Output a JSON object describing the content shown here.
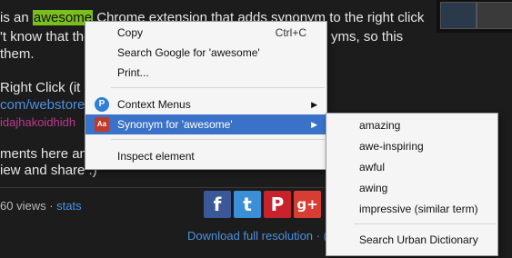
{
  "post": {
    "line1_before": " is an ",
    "highlighted_word": "awesome",
    "line1_after": " Chrome extension that adds synonym to the right click",
    "line2": "'t know that the",
    "line2_right": "yms, so this",
    "line3": " them.",
    "line4": "Right Click (it is",
    "line5_link": "com/webstore/",
    "line6_link": "idajhakoidhidh",
    "line7": "ments here an",
    "line8": "iew and share :)"
  },
  "footer": {
    "views_text": "60 views · ",
    "stats_link": "stats",
    "download_link": "Download full resolution",
    "download_suffix": " · ("
  },
  "social": {
    "facebook": "f",
    "twitter": "t",
    "pinterest": "P",
    "googleplus": "g+"
  },
  "context_menu": {
    "copy": "Copy",
    "copy_shortcut": "Ctrl+C",
    "search_google": "Search Google for 'awesome'",
    "print": "Print...",
    "context_menus": "Context Menus",
    "context_menus_icon": "P",
    "synonym": "Synonym for 'awesome'",
    "synonym_icon": "Aa",
    "inspect": "Inspect element"
  },
  "submenu": {
    "items": [
      "amazing",
      "awe-inspiring",
      "awful",
      "awing",
      "impressive (similar term)"
    ],
    "urban": "Search Urban Dictionary"
  },
  "colors": {
    "highlight": "#7bbf1f",
    "menu_selection": "#3a72c9",
    "link": "#4d91e0"
  }
}
